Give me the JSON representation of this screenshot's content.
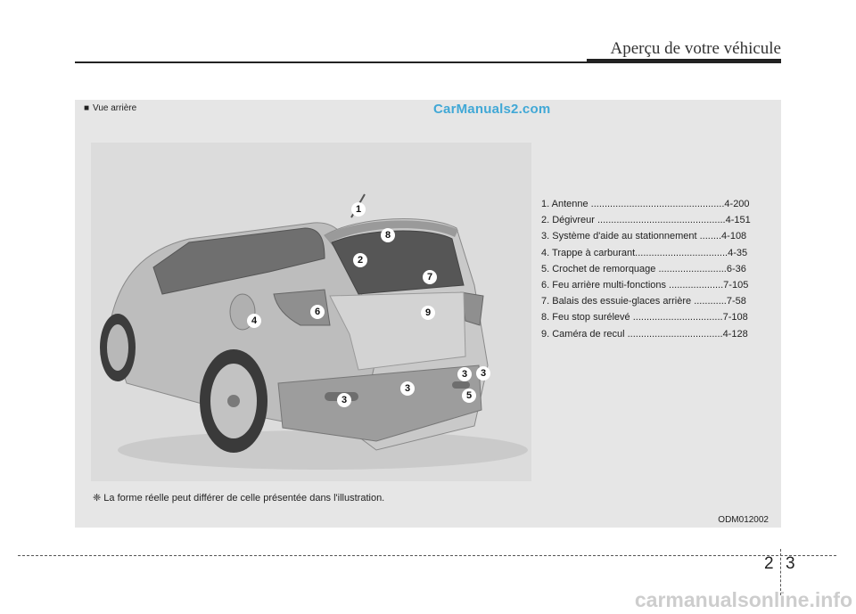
{
  "header": {
    "title": "Aperçu de votre véhicule"
  },
  "panel": {
    "section_label": "Vue arrière",
    "watermark": "CarManuals2.com",
    "legend": [
      "1. Antenne .................................................4-200",
      "2. Dégivreur ...............................................4-151",
      "3. Système d'aide au stationnement ........4-108",
      "4. Trappe à carburant..................................4-35",
      "5. Crochet de remorquage .........................6-36",
      "6. Feu arrière multi-fonctions ....................7-105",
      "7. Balais des essuie-glaces arrière ............7-58",
      "8. Feu stop surélevé .................................7-108",
      "9. Caméra de recul ...................................4-128"
    ],
    "callouts": [
      "1",
      "8",
      "2",
      "7",
      "6",
      "9",
      "4",
      "3",
      "3",
      "3",
      "3",
      "5"
    ],
    "note": "❈ La forme réelle peut différer de celle présentée dans l'illustration.",
    "figure_code": "ODM012002"
  },
  "page": {
    "left": "2",
    "right": "3"
  },
  "site_mark": "carmanualsonline.info"
}
